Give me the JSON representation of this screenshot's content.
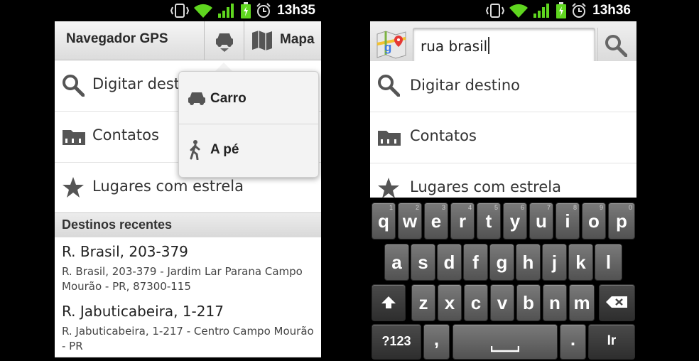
{
  "left": {
    "status": {
      "time": "13h35"
    },
    "header": {
      "title": "Navegador GPS",
      "map_label": "Mapa"
    },
    "menu": [
      {
        "label": "Digitar destino",
        "icon": "search-icon"
      },
      {
        "label": "Contatos",
        "icon": "folder-icon"
      },
      {
        "label": "Lugares com estrela",
        "icon": "star-icon"
      }
    ],
    "section_title": "Destinos recentes",
    "recent": [
      {
        "title": "R. Brasil, 203-379",
        "detail": "R. Brasil, 203-379 - Jardim Lar Parana Campo Mourão - PR, 87300-115"
      },
      {
        "title": "R. Jabuticabeira, 1-217",
        "detail": "R. Jabuticabeira, 1-217 - Centro Campo Mourão - PR"
      }
    ],
    "popup": [
      {
        "label": "Carro",
        "icon": "car-icon"
      },
      {
        "label": "A pé",
        "icon": "walk-icon"
      }
    ]
  },
  "right": {
    "status": {
      "time": "13h36"
    },
    "search": {
      "value": "rua brasil"
    },
    "menu": [
      {
        "label": "Digitar destino",
        "icon": "search-icon"
      },
      {
        "label": "Contatos",
        "icon": "folder-icon"
      },
      {
        "label": "Lugares com estrela",
        "icon": "star-icon"
      }
    ],
    "keyboard": {
      "row1": [
        {
          "k": "q",
          "h": "1"
        },
        {
          "k": "w",
          "h": "2"
        },
        {
          "k": "e",
          "h": "3"
        },
        {
          "k": "r",
          "h": "4"
        },
        {
          "k": "t",
          "h": "5"
        },
        {
          "k": "y",
          "h": "6"
        },
        {
          "k": "u",
          "h": "7"
        },
        {
          "k": "i",
          "h": "8"
        },
        {
          "k": "o",
          "h": "9"
        },
        {
          "k": "p",
          "h": "0"
        }
      ],
      "row2": [
        "a",
        "s",
        "d",
        "f",
        "g",
        "h",
        "j",
        "k",
        "l"
      ],
      "row3": [
        "z",
        "x",
        "c",
        "v",
        "b",
        "n",
        "m"
      ],
      "symbols_label": "?123",
      "comma": ",",
      "period": ".",
      "go_label": "Ir"
    }
  }
}
